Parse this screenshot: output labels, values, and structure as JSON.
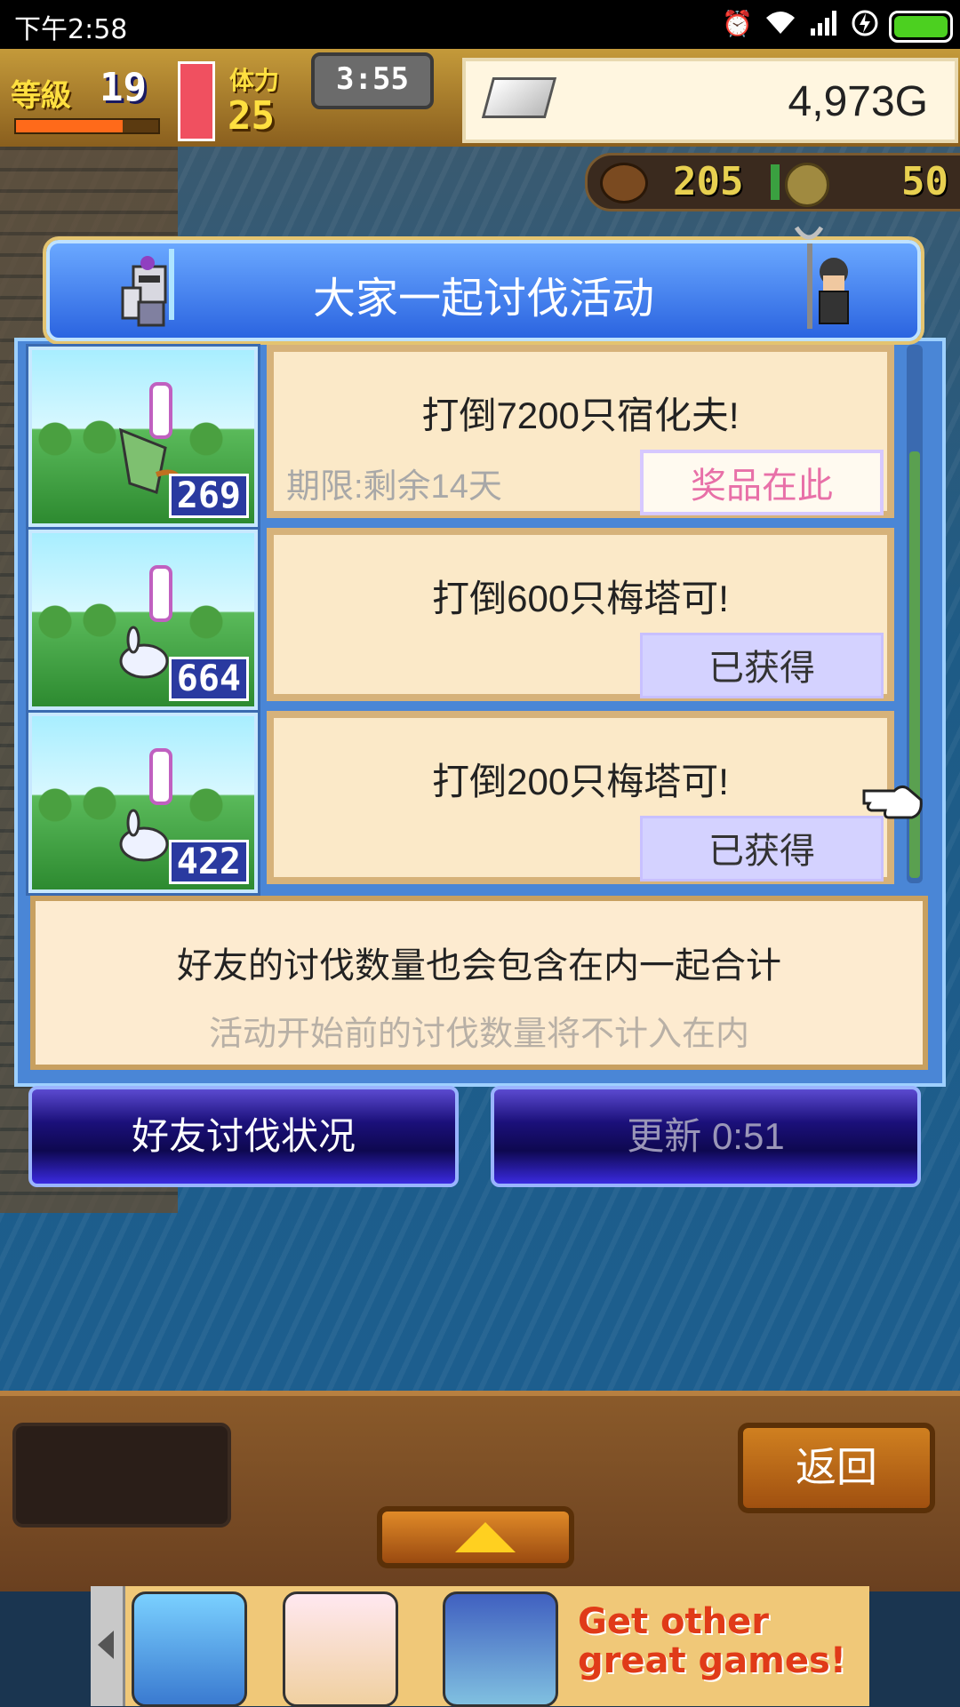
{
  "status_bar": {
    "time": "下午2:58"
  },
  "hud": {
    "level_label": "等級",
    "level": "19",
    "stamina_label": "体力",
    "stamina": "25",
    "timer": "3:55",
    "gold": "4,973G",
    "food": "205",
    "coins": "50",
    "level_progress": 0.75,
    "hp_fill": 1.0
  },
  "dialog": {
    "title": "大家一起讨伐活动",
    "missions": [
      {
        "text": "打倒7200只宿化夫!",
        "count": "269",
        "deadline": "期限:剩余14天",
        "button": "奖品在此",
        "state": "prize"
      },
      {
        "text": "打倒600只梅塔可!",
        "count": "664",
        "deadline": "",
        "button": "已获得",
        "state": "obtained"
      },
      {
        "text": "打倒200只梅塔可!",
        "count": "422",
        "deadline": "",
        "button": "已获得",
        "state": "obtained"
      }
    ],
    "notice_line1": "好友的讨伐数量也会包含在内一起合计",
    "notice_line2": "活动开始前的讨伐数量将不计入在内",
    "btn_friends": "好友讨伐状况",
    "btn_refresh": "更新 0:51"
  },
  "bottom": {
    "back": "返回"
  },
  "ad": {
    "text": "Get other great games!"
  },
  "colors": {
    "accent": "#2b64e0",
    "card": "#fbe9c8",
    "gold": "#ffe040"
  }
}
